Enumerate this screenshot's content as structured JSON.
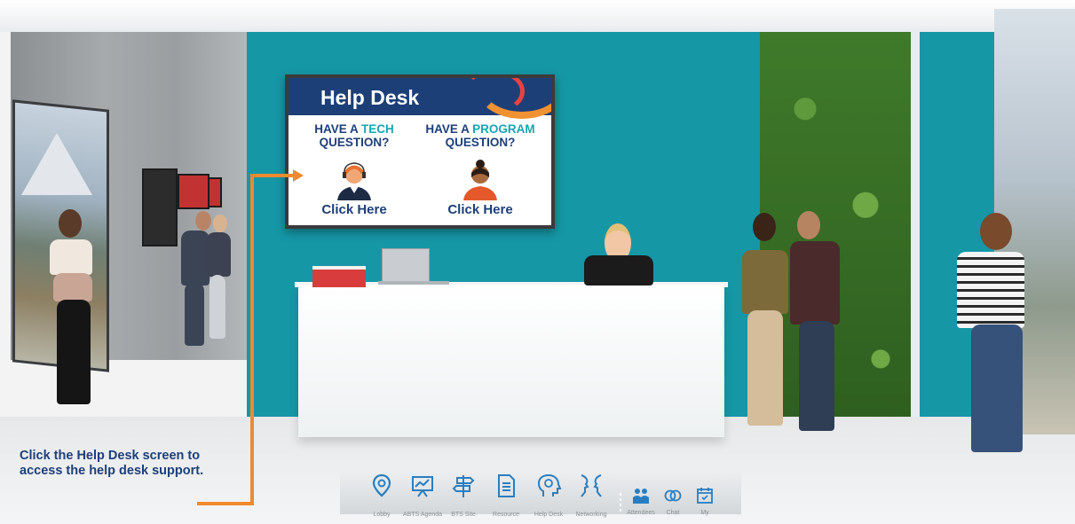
{
  "screen": {
    "title": "Help Desk",
    "tech": {
      "line1_pre": "HAVE A ",
      "line1_accent": "TECH",
      "line2": "QUESTION?",
      "link": "Click Here"
    },
    "program": {
      "line1_pre": "HAVE A ",
      "line1_accent": "PROGRAM",
      "line2": "QUESTION?",
      "link": "Click Here"
    }
  },
  "instruction": {
    "text": "Click the Help Desk screen to access the help desk support."
  },
  "colors": {
    "teal": "#1697a6",
    "navy": "#1d3f78",
    "orange": "#f08a2e",
    "accent_teal": "#16a6b6"
  },
  "nav": {
    "items": [
      {
        "icon": "location-pin-icon",
        "label": "Lobby"
      },
      {
        "icon": "presentation-board-icon",
        "label": "ABTS Agenda"
      },
      {
        "icon": "signpost-icon",
        "label": "BTS Site"
      },
      {
        "icon": "document-icon",
        "label": "Resource"
      },
      {
        "icon": "help-head-icon",
        "label": "Help Desk"
      },
      {
        "icon": "networking-faces-icon",
        "label": "Networking"
      }
    ],
    "small_items": [
      {
        "icon": "attendees-icon",
        "label": "Attendees"
      },
      {
        "icon": "chat-icon",
        "label": "Chat"
      },
      {
        "icon": "calendar-icon",
        "label": "My"
      }
    ]
  }
}
